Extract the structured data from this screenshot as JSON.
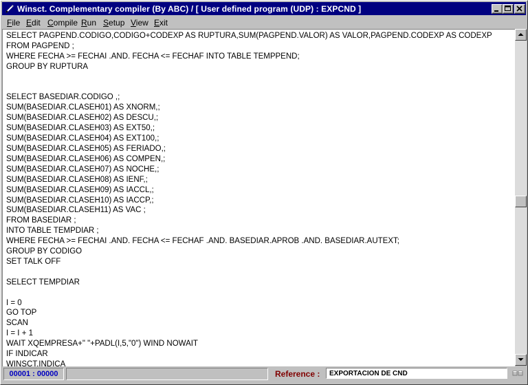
{
  "window": {
    "title": "Winsct. Complementary compiler (By ABC)  /   [ User defined program (UDP) : EXPCND ]"
  },
  "menu": {
    "items": [
      {
        "label": "File",
        "key": "F"
      },
      {
        "label": "Edit",
        "key": "E"
      },
      {
        "label": "Compile",
        "key": "C"
      },
      {
        "label": "Run",
        "key": "R"
      },
      {
        "label": "Setup",
        "key": "S"
      },
      {
        "label": "View",
        "key": "V"
      },
      {
        "label": "Exit",
        "key": "E"
      }
    ]
  },
  "editor": {
    "lines": [
      "SELECT PAGPEND.CODIGO,CODIGO+CODEXP AS RUPTURA,SUM(PAGPEND.VALOR) AS VALOR,PAGPEND.CODEXP AS CODEXP",
      "FROM PAGPEND ;",
      "WHERE FECHA >= FECHAI .AND. FECHA <= FECHAF INTO TABLE TEMPPEND;",
      "GROUP BY RUPTURA",
      "",
      "",
      "SELECT BASEDIAR.CODIGO ,;",
      "SUM(BASEDIAR.CLASEH01) AS XNORM,;",
      "SUM(BASEDIAR.CLASEH02) AS DESCU,;",
      "SUM(BASEDIAR.CLASEH03) AS EXT50,;",
      "SUM(BASEDIAR.CLASEH04) AS EXT100,;",
      "SUM(BASEDIAR.CLASEH05) AS FERIADO,;",
      "SUM(BASEDIAR.CLASEH06) AS COMPEN,;",
      "SUM(BASEDIAR.CLASEH07) AS NOCHE,;",
      "SUM(BASEDIAR.CLASEH08) AS IENF,;",
      "SUM(BASEDIAR.CLASEH09) AS IACCL,;",
      "SUM(BASEDIAR.CLASEH10) AS IACCP,;",
      "SUM(BASEDIAR.CLASEH11) AS VAC ;",
      "FROM BASEDIAR ;",
      "INTO TABLE TEMPDIAR ;",
      "WHERE FECHA >= FECHAI .AND. FECHA <= FECHAF .AND. BASEDIAR.APROB .AND. BASEDIAR.AUTEXT;",
      "GROUP BY CODIGO",
      "SET TALK OFF",
      "",
      "SELECT TEMPDIAR",
      "",
      "I = 0",
      "GO TOP",
      "SCAN",
      "I = I + 1",
      "WAIT XQEMPRESA+\" \"+PADL(I,5,\"0\") WIND NOWAIT",
      "IF INDICAR",
      "WINSCT.INDICA"
    ]
  },
  "status": {
    "position": "00001 : 00000",
    "reference_label": "Reference :",
    "reference_value": "EXPORTACION DE CND"
  }
}
